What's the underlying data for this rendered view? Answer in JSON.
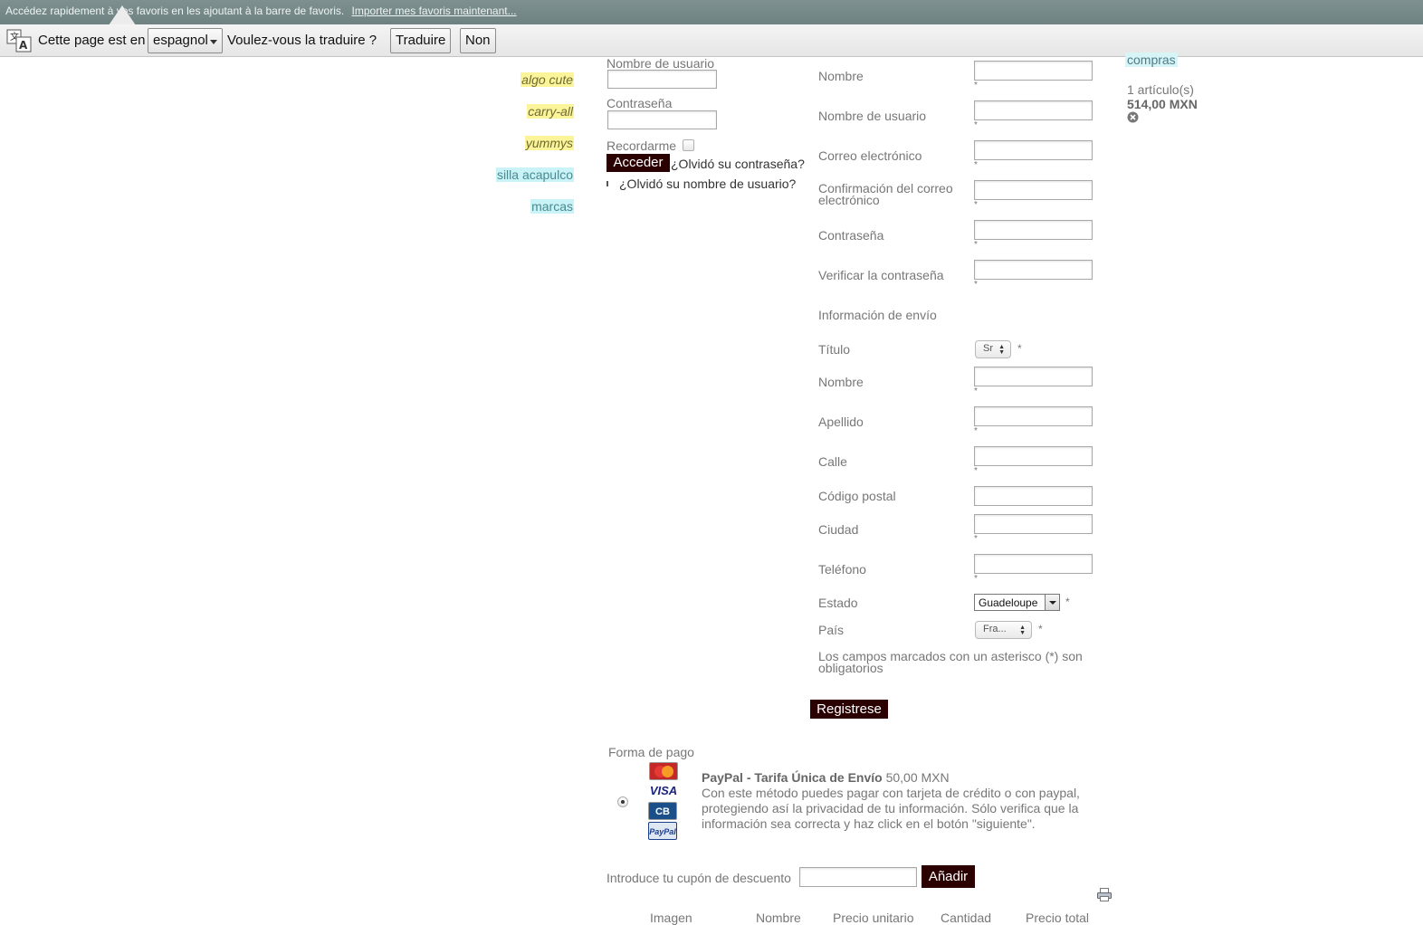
{
  "bookmark_bar": {
    "message": "Accédez rapidement à vos favoris en les ajoutant à la barre de favoris.",
    "import_link": "Importer mes favoris maintenant..."
  },
  "translate_bar": {
    "prefix": "Cette page est en",
    "language": "espagnol",
    "question": "Voulez-vous la traduire ?",
    "translate_button": "Traduire",
    "no_button": "Non"
  },
  "tags": [
    "algo cute",
    "carry-all",
    "yummys",
    "silla acapulco",
    "marcas"
  ],
  "login": {
    "username_label": "Nombre de usuario",
    "password_label": "Contraseña",
    "remember_label": "Recordarme",
    "submit_label": "Acceder",
    "forgot_password": "¿Olvidó su contraseña?",
    "forgot_username": "¿Olvidó su nombre de usuario?"
  },
  "register": {
    "name": "Nombre",
    "username": "Nombre de usuario",
    "email": "Correo electrónico",
    "email_confirm": "Confirmación del correo electrónico",
    "password": "Contraseña",
    "password_verify": "Verificar la contraseña",
    "shipping_heading": "Información de envío",
    "title_label": "Título",
    "title_value": "Sr",
    "ship_name": "Nombre",
    "surname": "Apellido",
    "street": "Calle",
    "postal_code": "Código postal",
    "city": "Ciudad",
    "phone": "Teléfono",
    "state_label": "Estado",
    "state_value": "Guadeloupe",
    "country_label": "País",
    "country_value": "Fra...",
    "required_note": "Los campos marcados con un asterisco (*) son obligatorios",
    "submit_label": "Registrese",
    "asterisk": "*"
  },
  "payment": {
    "heading": "Forma de pago",
    "method_name": "PayPal - Tarifa Única de Envío",
    "method_price": "50,00 MXN",
    "description": "Con este método puedes pagar con tarjeta de crédito o con paypal, protegiendo así la privacidad de tu información. Sólo verifica que la información sea correcta y haz click en el botón \"siguiente\".",
    "card_labels": [
      "MasterCard",
      "VISA",
      "CB",
      "PayPal"
    ]
  },
  "coupon": {
    "label": "Introduce tu cupón de descuento",
    "button": "Añadir"
  },
  "cart_table": {
    "headers": [
      "Imagen",
      "Nombre",
      "Precio unitario",
      "Cantidad",
      "Precio total"
    ]
  },
  "cart": {
    "title": "compras",
    "count": "1 artículo(s)",
    "total": "514,00 MXN"
  },
  "colors": {
    "dark_button": "#2a0000",
    "tag_yellow": "#fbf498",
    "tag_cyan": "#c9f3f6"
  }
}
